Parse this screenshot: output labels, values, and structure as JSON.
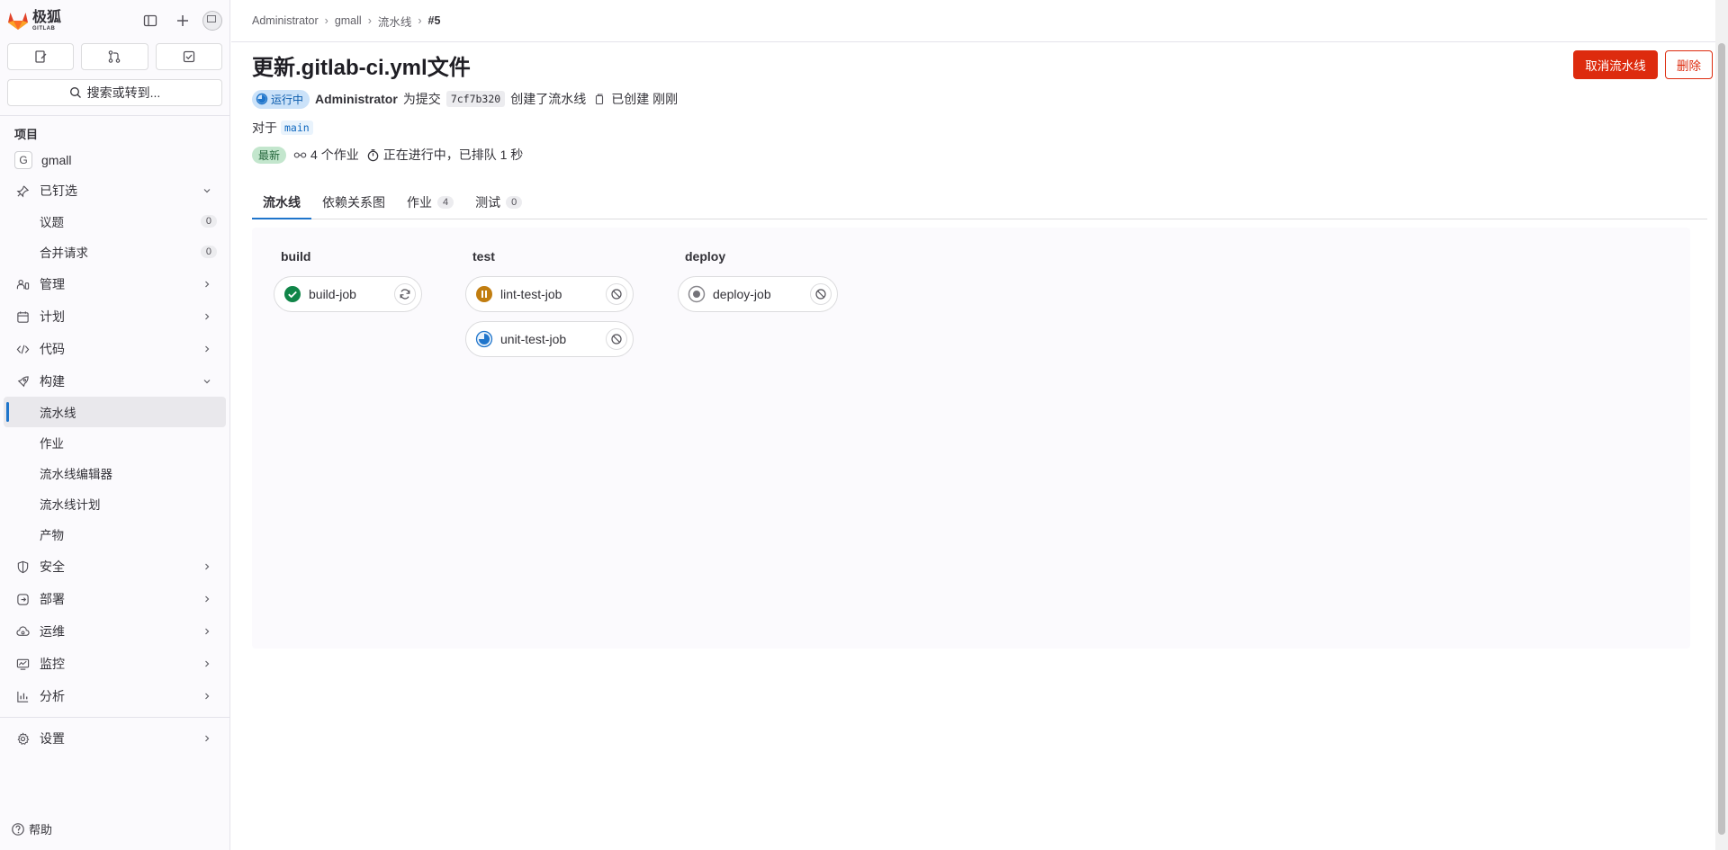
{
  "sidebar": {
    "brand_zh": "极狐",
    "brand_en": "GITLAB",
    "search_label": "搜索或转到...",
    "section_title": "项目",
    "project_initial": "G",
    "project_name": "gmall",
    "pinned": {
      "label": "已钉选",
      "items": [
        {
          "label": "议题",
          "count": "0"
        },
        {
          "label": "合并请求",
          "count": "0"
        }
      ]
    },
    "nav": [
      {
        "label": "管理",
        "icon": "users-icon"
      },
      {
        "label": "计划",
        "icon": "calendar-icon"
      },
      {
        "label": "代码",
        "icon": "code-icon"
      }
    ],
    "build": {
      "label": "构建",
      "items": [
        "流水线",
        "作业",
        "流水线编辑器",
        "流水线计划",
        "产物"
      ]
    },
    "nav2": [
      {
        "label": "安全",
        "icon": "shield-icon"
      },
      {
        "label": "部署",
        "icon": "deploy-icon"
      },
      {
        "label": "运维",
        "icon": "cloud-gear-icon"
      },
      {
        "label": "监控",
        "icon": "monitor-icon"
      },
      {
        "label": "分析",
        "icon": "chart-icon"
      }
    ],
    "settings_label": "设置",
    "help_label": "帮助"
  },
  "breadcrumb": {
    "items": [
      "Administrator",
      "gmall",
      "流水线"
    ],
    "current": "#5"
  },
  "pipeline": {
    "title": "更新.gitlab-ci.yml文件",
    "cancel_label": "取消流水线",
    "delete_label": "删除",
    "status": "运行中",
    "author": "Administrator",
    "for_commit_text": "为提交",
    "commit_sha": "7cf7b320",
    "created_text": "创建了流水线",
    "created_time_text": "已创建 刚刚",
    "ref_prefix": "对于",
    "ref": "main",
    "latest_badge": "最新",
    "jobs_count_text": "4 个作业",
    "duration_text": "正在进行中，已排队 1 秒"
  },
  "tabs": [
    {
      "label": "流水线",
      "count": null
    },
    {
      "label": "依赖关系图",
      "count": null
    },
    {
      "label": "作业",
      "count": "4"
    },
    {
      "label": "测试",
      "count": "0"
    }
  ],
  "stages": [
    {
      "name": "build",
      "jobs": [
        {
          "name": "build-job",
          "status": "success",
          "action": "retry"
        }
      ]
    },
    {
      "name": "test",
      "jobs": [
        {
          "name": "lint-test-job",
          "status": "paused",
          "action": "cancel"
        },
        {
          "name": "unit-test-job",
          "status": "running",
          "action": "cancel"
        }
      ]
    },
    {
      "name": "deploy",
      "jobs": [
        {
          "name": "deploy-job",
          "status": "created",
          "action": "cancel"
        }
      ]
    }
  ],
  "colors": {
    "accent": "#1f75cb",
    "danger": "#dd2b0e",
    "success": "#108548",
    "warning": "#c17d10",
    "running": "#1f75cb"
  }
}
